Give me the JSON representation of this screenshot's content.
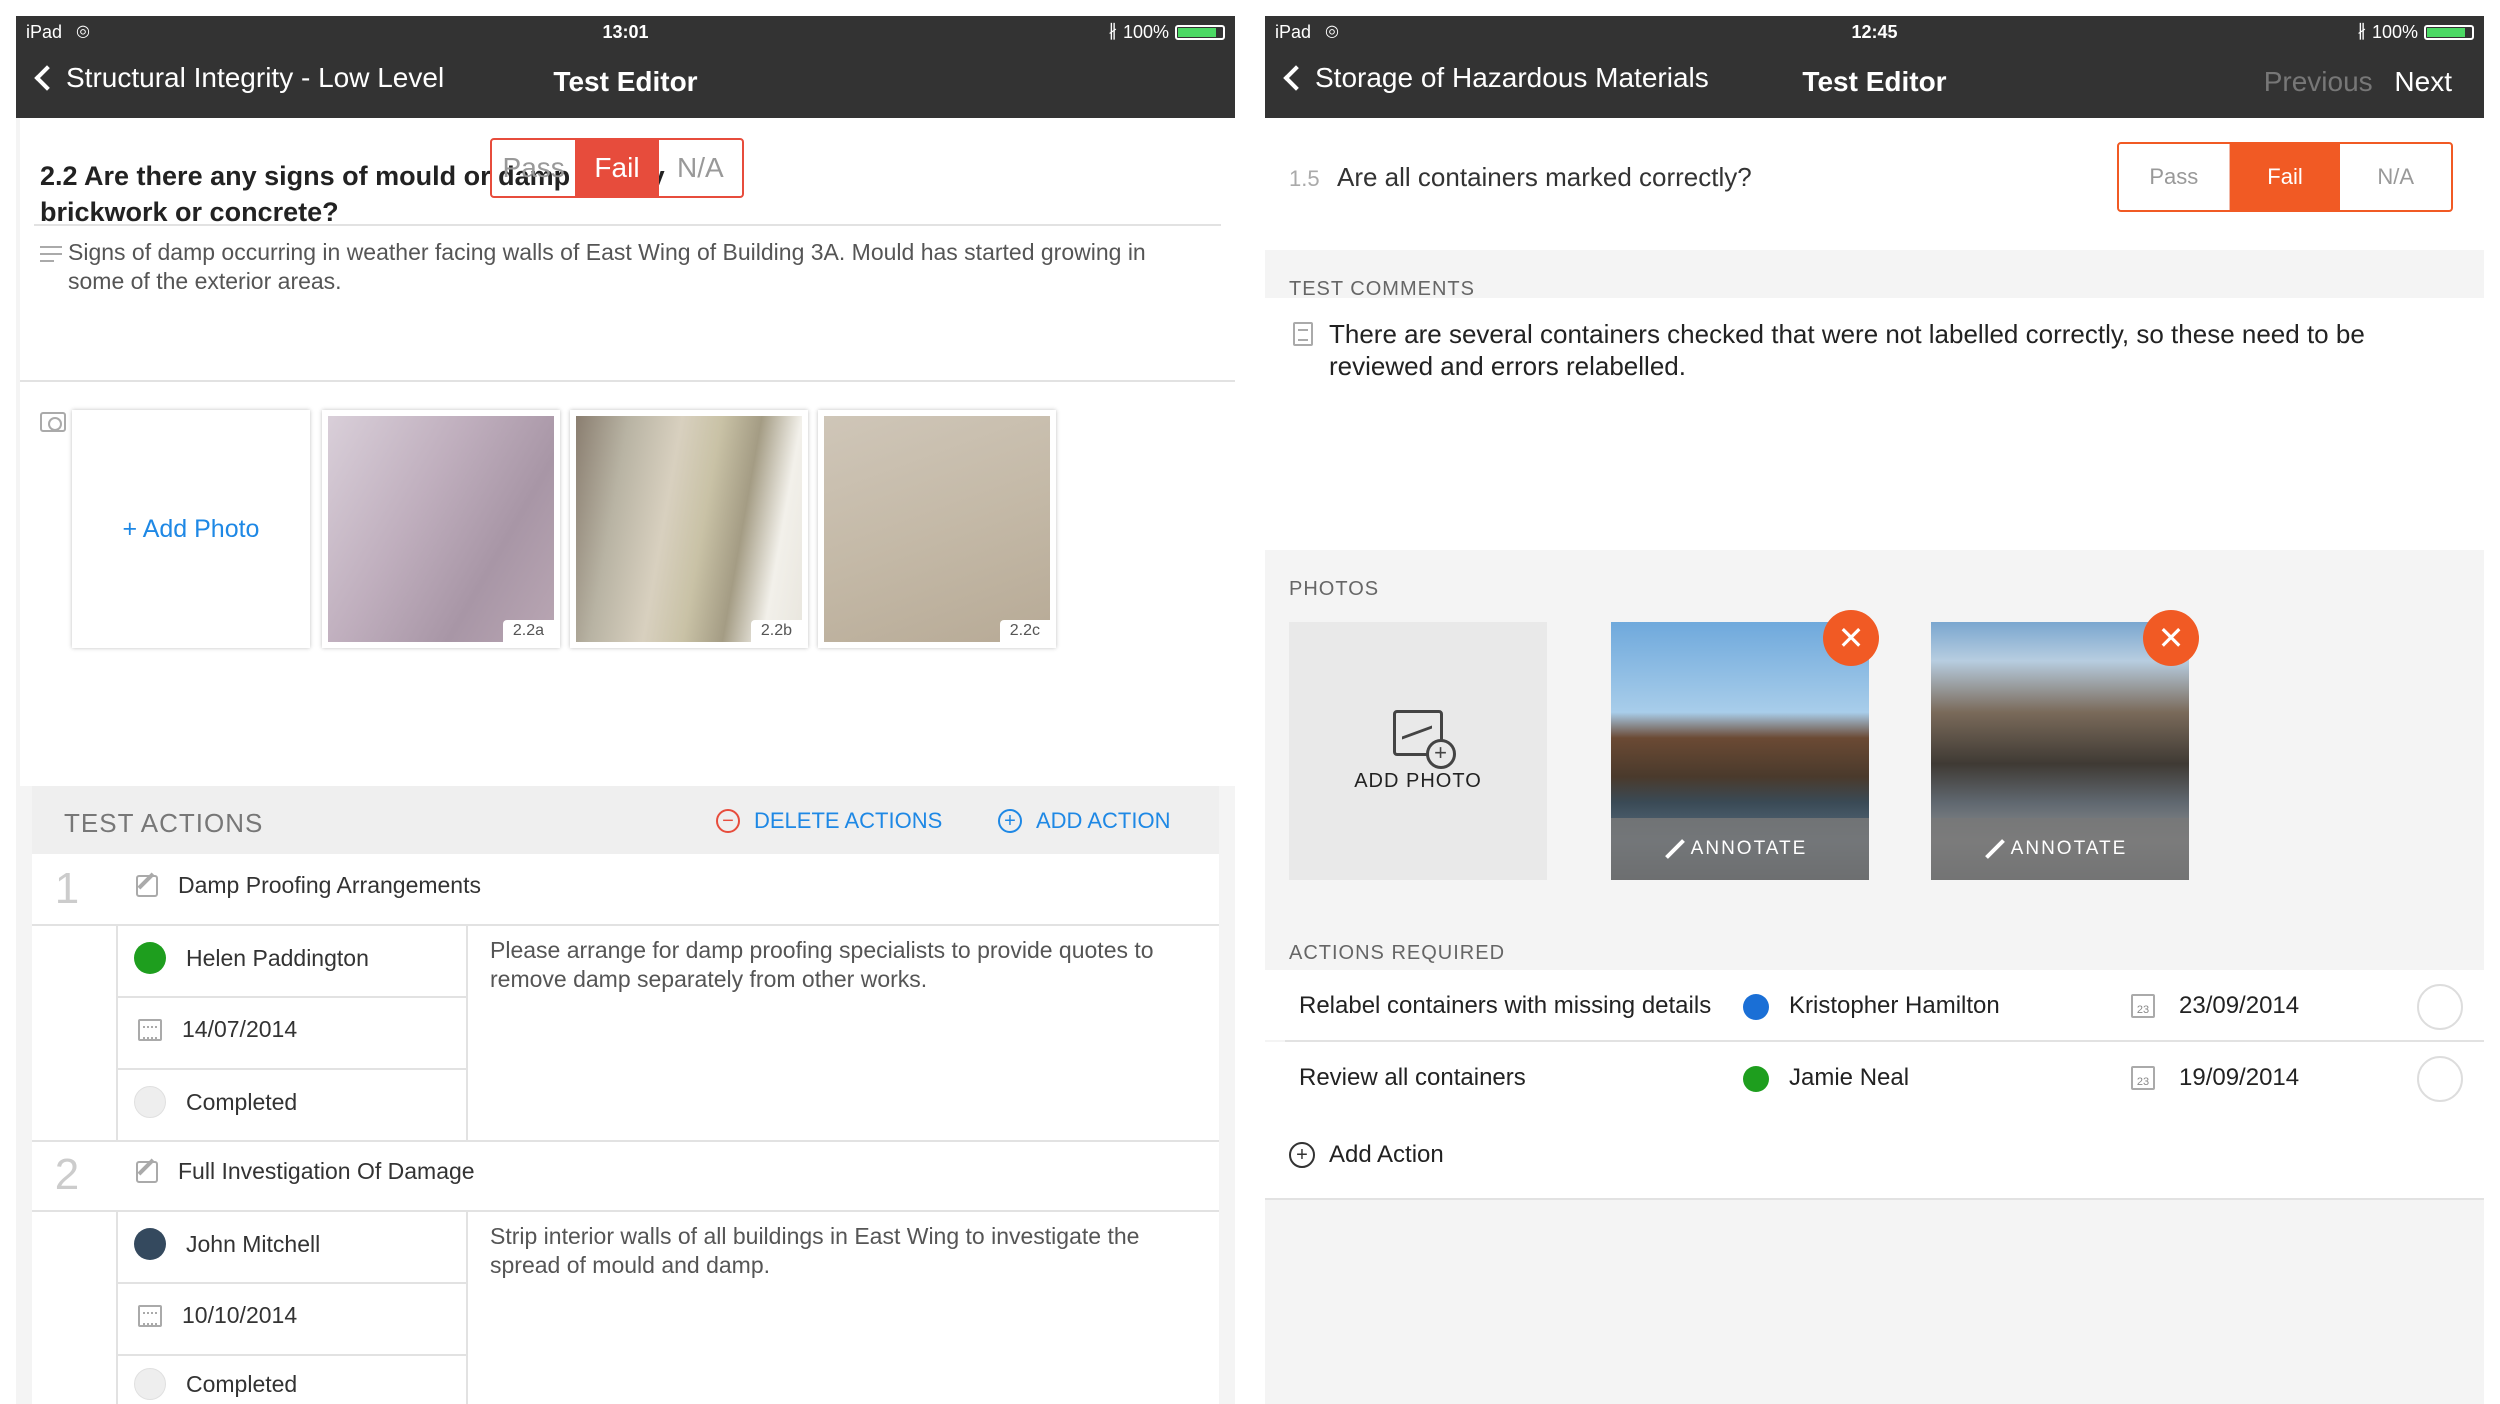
{
  "colors": {
    "fail": "#e74c3c",
    "accent_blue": "#1e88e5",
    "header_bg": "#333333",
    "close_orange": "#f15a24"
  },
  "left": {
    "status": {
      "device": "iPad",
      "time": "13:01",
      "battery": "100%"
    },
    "nav": {
      "back_label": "Structural Integrity - Low Level",
      "title": "Test Editor"
    },
    "question": {
      "text": "2.2 Are there any signs of mould or damp on any brickwork or concrete?",
      "options": [
        "Pass",
        "Fail",
        "N/A"
      ],
      "selected": "Fail"
    },
    "comment": "Signs of damp occurring in weather facing walls of East Wing of Building 3A. Mould has started growing in some of the exterior areas.",
    "photos": {
      "add_label": "+ Add Photo",
      "items": [
        {
          "tag": "2.2a"
        },
        {
          "tag": "2.2b"
        },
        {
          "tag": "2.2c"
        }
      ]
    },
    "actions": {
      "header": "TEST ACTIONS",
      "delete_label": "DELETE ACTIONS",
      "add_label": "ADD ACTION",
      "items": [
        {
          "num": "1",
          "title": "Damp Proofing Arrangements",
          "assignee": "Helen Paddington",
          "assignee_color": "#1e9e1e",
          "date": "14/07/2014",
          "status": "Completed",
          "description": "Please arrange for damp proofing specialists to provide quotes to remove damp separately from other works."
        },
        {
          "num": "2",
          "title": "Full Investigation Of Damage",
          "assignee": "John Mitchell",
          "assignee_color": "#34495e",
          "date": "10/10/2014",
          "status": "Completed",
          "description": "Strip interior walls of all buildings in East Wing to investigate the spread of mould and damp."
        }
      ]
    }
  },
  "right": {
    "status": {
      "device": "iPad",
      "time": "12:45",
      "battery": "100%"
    },
    "nav": {
      "back_label": "Storage of Hazardous Materials",
      "title": "Test Editor",
      "previous": "Previous",
      "next": "Next"
    },
    "question": {
      "num": "1.5",
      "text": "Are all containers marked correctly?",
      "options": [
        "Pass",
        "Fail",
        "N/A"
      ],
      "selected": "Fail"
    },
    "comments_label": "TEST COMMENTS",
    "comment": "There are several containers checked that were not labelled correctly, so these need to be reviewed and errors relabelled.",
    "photos_label": "PHOTOS",
    "add_photo_label": "ADD PHOTO",
    "annotate_label": "ANNOTATE",
    "actions_label": "ACTIONS REQUIRED",
    "actions": [
      {
        "title": "Relabel containers with missing details",
        "assignee": "Kristopher Hamilton",
        "assignee_color": "#1a6fd6",
        "date": "23/09/2014",
        "cal_num": "23"
      },
      {
        "title": "Review all containers",
        "assignee": "Jamie Neal",
        "assignee_color": "#1e9e1e",
        "date": "19/09/2014",
        "cal_num": "23"
      }
    ],
    "add_action_label": "Add Action"
  }
}
